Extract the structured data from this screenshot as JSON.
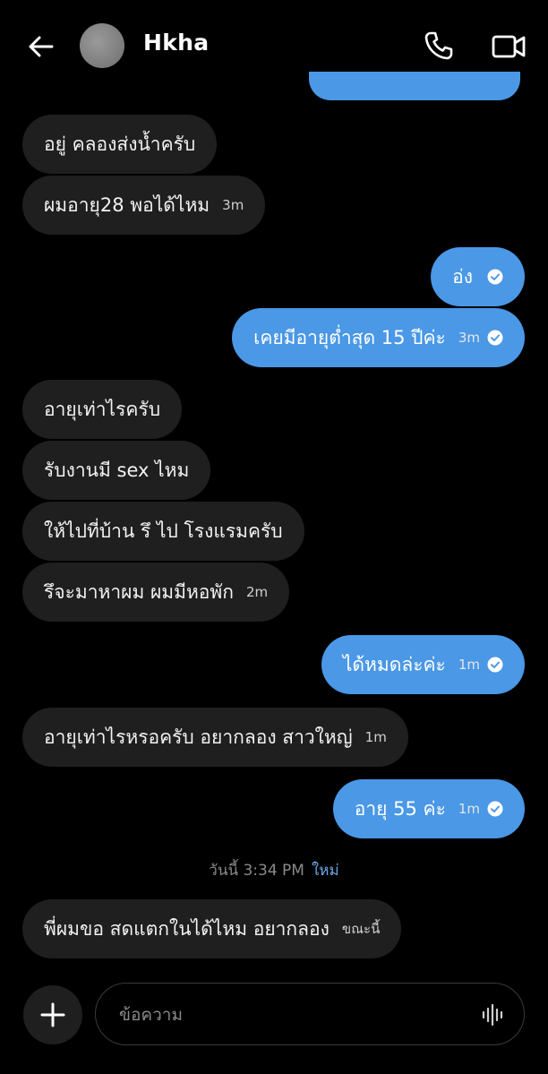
{
  "header": {
    "contact_name": "Hkha"
  },
  "messages": [
    {
      "id": "m1",
      "side": "in",
      "text": "อยู่ คลองส่งน้ำครับ",
      "time": ""
    },
    {
      "id": "m2",
      "side": "in",
      "text": "ผมอายุ28 พอได้ไหม",
      "time": "3m"
    },
    {
      "id": "m3",
      "side": "out",
      "text": "อ่ง",
      "time": ""
    },
    {
      "id": "m4",
      "side": "out",
      "text": "เคยมีอายุต่ำสุด 15 ปีค่ะ",
      "time": "3m"
    },
    {
      "id": "m5",
      "side": "in",
      "text": "อายุเท่าไรครับ",
      "time": ""
    },
    {
      "id": "m6",
      "side": "in",
      "text": "รับงานมี sex ไหม",
      "time": ""
    },
    {
      "id": "m7",
      "side": "in",
      "text": "ให้ไปที่บ้าน รึ ไป โรงแรมครับ",
      "time": ""
    },
    {
      "id": "m8",
      "side": "in",
      "text": "รึจะมาหาผม ผมมีหอพัก",
      "time": "2m"
    },
    {
      "id": "m9",
      "side": "out",
      "text": "ได้หมดล่ะค่ะ",
      "time": "1m"
    },
    {
      "id": "m10",
      "side": "in",
      "text": "อายุเท่าไรหรอครับ อยากลอง สาวใหญ่",
      "time": "1m"
    },
    {
      "id": "m11",
      "side": "out",
      "text": "อายุ 55 ค่ะ",
      "time": "1m"
    },
    {
      "id": "m12",
      "side": "in",
      "text": "พี่ผมขอ สดแตกในได้ไหม อยากลอง",
      "time": "ขณะนี้"
    }
  ],
  "timestamp": {
    "text": "วันนี้ 3:34 PM",
    "new_label": "ใหม่"
  },
  "composer": {
    "placeholder": "ข้อความ"
  },
  "icons": {
    "back": "arrow-left-icon",
    "call": "phone-icon",
    "video": "video-camera-icon",
    "add": "plus-icon",
    "voice": "voice-waveform-icon",
    "read": "check-circle-icon"
  },
  "colors": {
    "outgoing_bubble": "#4a98e6",
    "incoming_bubble": "#1f1f1f",
    "background": "#000000"
  }
}
